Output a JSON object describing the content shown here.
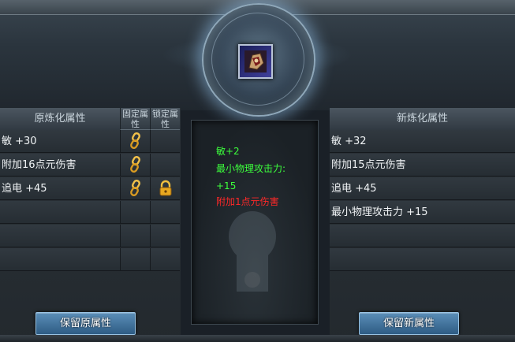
{
  "item": {
    "icon": "armor-item-icon"
  },
  "left": {
    "header": "原炼化属性",
    "col_fixed": "固定属性",
    "col_locked": "锁定属性",
    "rows": [
      {
        "text": "敏 +30",
        "fixed": true,
        "locked": false
      },
      {
        "text": "附加16点元伤害",
        "fixed": true,
        "locked": false
      },
      {
        "text": "追电 +45",
        "fixed": true,
        "locked": true
      },
      {
        "text": "",
        "fixed": false,
        "locked": false
      },
      {
        "text": "",
        "fixed": false,
        "locked": false
      },
      {
        "text": "",
        "fixed": false,
        "locked": false
      }
    ],
    "button": "保留原属性"
  },
  "center": {
    "lines": [
      {
        "text": "敏+2",
        "color": "#3cff3c"
      },
      {
        "text": "最小物理攻击力:",
        "color": "#3cff3c"
      },
      {
        "text": "+15",
        "color": "#3cff3c"
      },
      {
        "text": "附加1点元伤害",
        "color": "#ff2828"
      }
    ]
  },
  "right": {
    "header": "新炼化属性",
    "rows": [
      {
        "text": "敏 +32"
      },
      {
        "text": "附加15点元伤害"
      },
      {
        "text": "追电 +45"
      },
      {
        "text": "最小物理攻击力 +15"
      },
      {
        "text": ""
      },
      {
        "text": ""
      }
    ],
    "button": "保留新属性"
  }
}
